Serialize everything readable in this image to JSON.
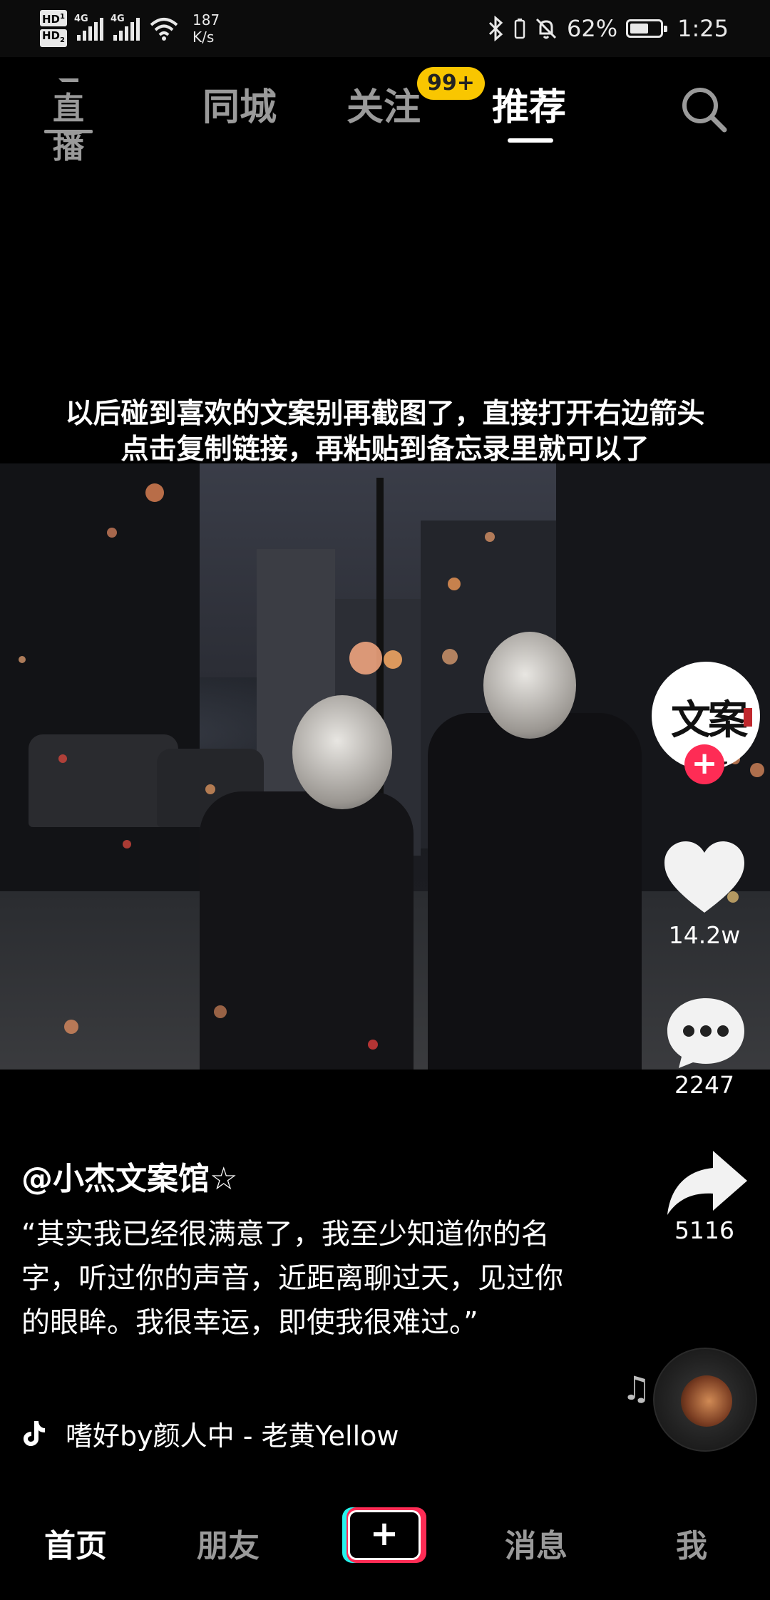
{
  "status_bar": {
    "hd1": "HD",
    "hd1_sub": "1",
    "hd2": "HD",
    "hd2_sub": "2",
    "net1": "4G",
    "net2": "4G",
    "speed_value": "187",
    "speed_unit": "K/s",
    "battery": "62%",
    "battery_level": 0.62,
    "time": "1:25"
  },
  "top_nav": {
    "live_label": "直播",
    "tabs": [
      {
        "label": "同城",
        "active": false
      },
      {
        "label": "关注",
        "active": false
      },
      {
        "label": "推荐",
        "active": true
      }
    ],
    "follow_badge": "99+",
    "search_icon": "search-icon"
  },
  "video": {
    "caption_line1": "以后碰到喜欢的文案别再截图了，直接打开右边箭头",
    "caption_line2": "点击复制链接，再粘贴到备忘录里就可以了"
  },
  "right_rail": {
    "avatar_text": "文案館",
    "follow_plus": "+",
    "like_count": "14.2w",
    "comment_count": "2247",
    "share_count": "5116",
    "colors": {
      "follow": "#fe2c55"
    }
  },
  "description": {
    "author": "@小杰文案馆☆",
    "text": "“其实我已经很满意了，我至少知道你的名字，听过你的声音，近距离聊过天，见过你的眼眸。我很幸运，即使我很难过。”",
    "music": "嗜好by颜人中 - 老黄Yellow"
  },
  "bottom_bar": {
    "home": "首页",
    "friends": "朋友",
    "create": "+",
    "messages": "消息",
    "me": "我",
    "colors": {
      "cyan": "#25f4ee",
      "red": "#fe2c55"
    }
  }
}
